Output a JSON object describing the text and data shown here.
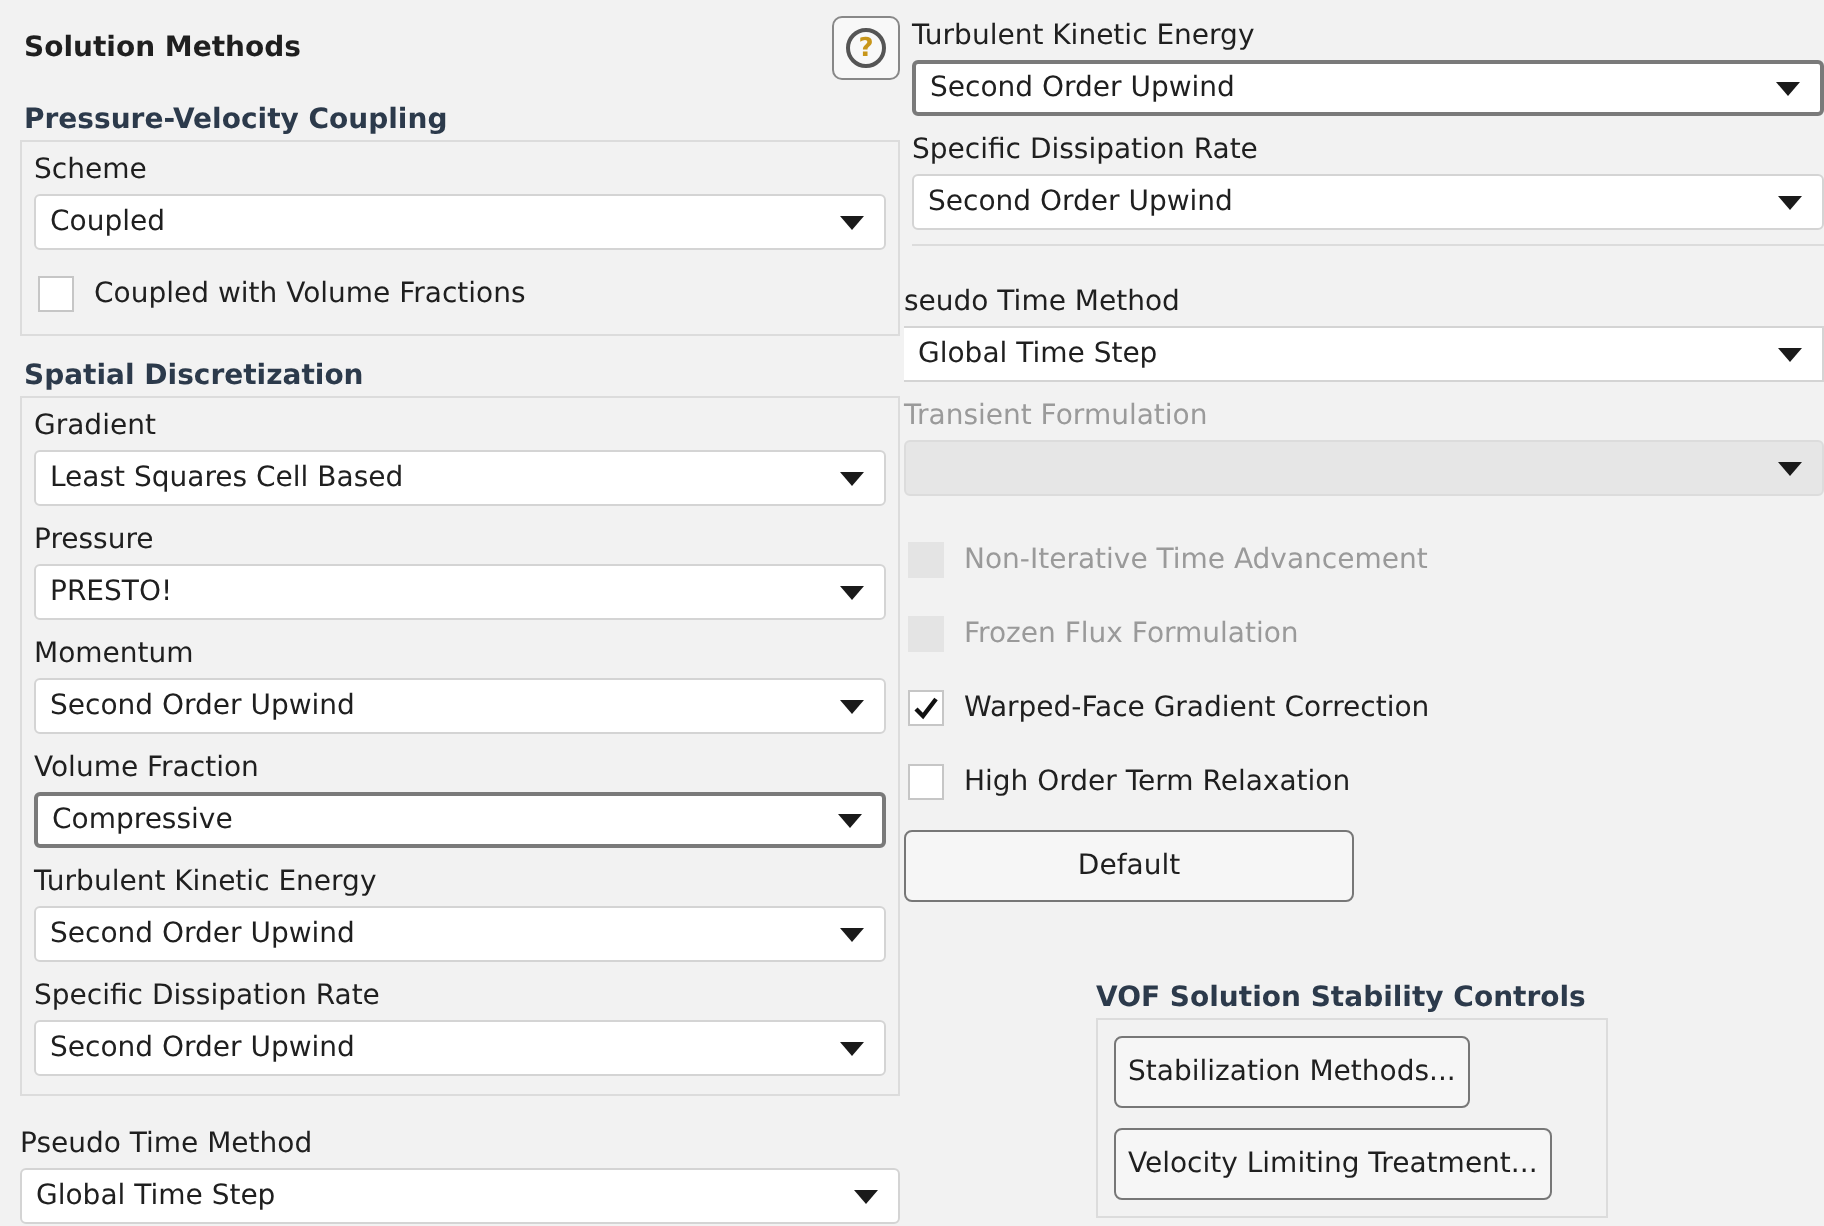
{
  "title": "Solution Methods",
  "help_button": "?",
  "left_column": [
    {
      "heading": "Pressure-Velocity Coupling",
      "boxed": true,
      "items": [
        {
          "kind": "dropdown",
          "label": "Scheme",
          "value": "Coupled",
          "focused": false,
          "disabled": false
        },
        {
          "kind": "checkbox",
          "label": "Coupled with Volume Fractions",
          "checked": false,
          "disabled": false
        }
      ]
    },
    {
      "heading": "Spatial Discretization",
      "boxed": true,
      "items": [
        {
          "kind": "dropdown",
          "label": "Gradient",
          "value": "Least Squares Cell Based",
          "focused": false,
          "disabled": false
        },
        {
          "kind": "dropdown",
          "label": "Pressure",
          "value": "PRESTO!",
          "focused": false,
          "disabled": false
        },
        {
          "kind": "dropdown",
          "label": "Momentum",
          "value": "Second Order Upwind",
          "focused": false,
          "disabled": false
        },
        {
          "kind": "dropdown",
          "label": "Volume Fraction",
          "value": "Compressive",
          "focused": true,
          "disabled": false
        },
        {
          "kind": "dropdown",
          "label": "Turbulent Kinetic Energy",
          "value": "Second Order Upwind",
          "focused": false,
          "disabled": false
        },
        {
          "kind": "dropdown",
          "label": "Specific Dissipation Rate",
          "value": "Second Order Upwind",
          "focused": false,
          "disabled": false
        }
      ]
    },
    {
      "items": [
        {
          "kind": "dropdown",
          "label": "Pseudo Time Method",
          "value": "Global Time Step",
          "focused": false,
          "disabled": false
        }
      ]
    }
  ],
  "right_column": [
    {
      "items": [
        {
          "kind": "dropdown",
          "label": "Turbulent Kinetic Energy",
          "value": "Second Order Upwind",
          "focused": true,
          "disabled": false
        },
        {
          "kind": "dropdown",
          "label": "Specific Dissipation Rate",
          "value": "Second Order Upwind",
          "focused": false,
          "disabled": false
        }
      ]
    },
    {
      "items": [
        {
          "kind": "dropdown",
          "label": "seudo Time Method",
          "value": "Global Time Step",
          "focused": false,
          "disabled": false
        },
        {
          "kind": "dropdown",
          "label": "Transient Formulation",
          "focused": false,
          "disabled": true
        }
      ]
    },
    {
      "items": [
        {
          "kind": "checkbox",
          "label": "Non-Iterative Time Advancement",
          "checked": false,
          "disabled": true
        },
        {
          "kind": "checkbox",
          "label": "Frozen Flux Formulation",
          "checked": false,
          "disabled": true
        },
        {
          "kind": "checkbox",
          "label": "Warped-Face Gradient Correction",
          "checked": true,
          "disabled": false
        },
        {
          "kind": "checkbox",
          "label": "High Order Term Relaxation",
          "checked": false,
          "disabled": false
        }
      ]
    }
  ],
  "default_button": "Default",
  "stability_controls": {
    "title": "VOF Solution Stability Controls",
    "buttons": [
      "Stabilization Methods...",
      "Velocity Limiting Treatment..."
    ]
  }
}
